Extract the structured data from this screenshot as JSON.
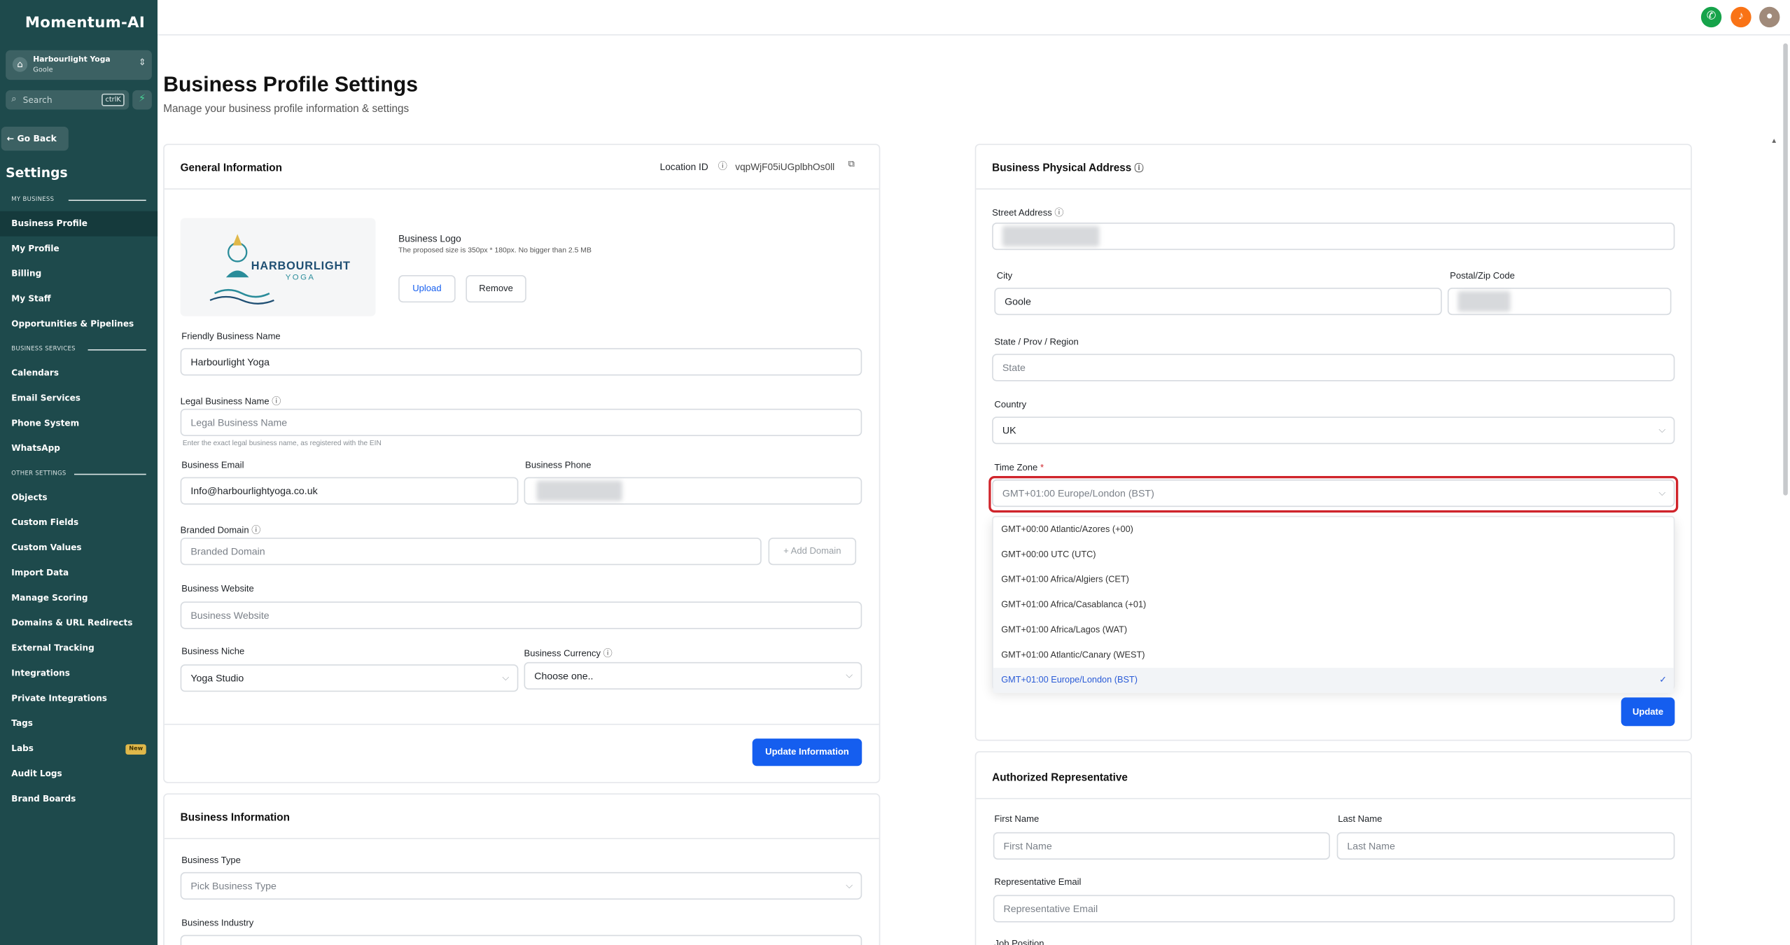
{
  "app": {
    "name": "Momentum-AI"
  },
  "account": {
    "name": "Harbourlight Yoga",
    "location": "Goole"
  },
  "search": {
    "placeholder": "Search",
    "shortcut": "ctrlK"
  },
  "sidebar": {
    "go_back": "Go Back",
    "title": "Settings",
    "sections": {
      "my_business": "MY BUSINESS",
      "business_services": "BUSINESS SERVICES",
      "other_settings": "OTHER SETTINGS"
    },
    "items": [
      {
        "label": "Business Profile"
      },
      {
        "label": "My Profile"
      },
      {
        "label": "Billing"
      },
      {
        "label": "My Staff"
      },
      {
        "label": "Opportunities & Pipelines"
      },
      {
        "label": "Calendars"
      },
      {
        "label": "Email Services"
      },
      {
        "label": "Phone System"
      },
      {
        "label": "WhatsApp"
      },
      {
        "label": "Objects"
      },
      {
        "label": "Custom Fields"
      },
      {
        "label": "Custom Values"
      },
      {
        "label": "Import Data"
      },
      {
        "label": "Manage Scoring"
      },
      {
        "label": "Domains & URL Redirects"
      },
      {
        "label": "External Tracking"
      },
      {
        "label": "Integrations"
      },
      {
        "label": "Private Integrations"
      },
      {
        "label": "Tags"
      },
      {
        "label": "Labs"
      },
      {
        "label": "Audit Logs"
      },
      {
        "label": "Brand Boards"
      }
    ],
    "labs_badge": "New"
  },
  "page": {
    "title": "Business Profile Settings",
    "subtitle": "Manage your business profile information & settings"
  },
  "general": {
    "title": "General Information",
    "location_id_label": "Location ID",
    "location_id": "vqpWjF05iUGplbhOs0ll",
    "logo_label": "Business Logo",
    "logo_hint": "The proposed size is 350px * 180px. No bigger than 2.5 MB",
    "upload": "Upload",
    "remove": "Remove",
    "logo_text": "HARBOURLIGHT",
    "logo_sub": "YOGA",
    "friendly_name_label": "Friendly Business Name",
    "friendly_name": "Harbourlight Yoga",
    "legal_name_label": "Legal Business Name",
    "legal_name_placeholder": "Legal Business Name",
    "legal_name_hint": "Enter the exact legal business name, as registered with the EIN",
    "email_label": "Business Email",
    "email": "Info@harbourlightyoga.co.uk",
    "phone_label": "Business Phone",
    "domain_label": "Branded Domain",
    "domain_placeholder": "Branded Domain",
    "add_domain": "+ Add Domain",
    "website_label": "Business Website",
    "website_placeholder": "Business Website",
    "niche_label": "Business Niche",
    "niche": "Yoga Studio",
    "currency_label": "Business Currency",
    "currency_placeholder": "Choose one..",
    "update_button": "Update Information"
  },
  "business_info": {
    "title": "Business Information",
    "type_label": "Business Type",
    "type_placeholder": "Pick Business Type",
    "industry_label": "Business Industry"
  },
  "address": {
    "title": "Business Physical Address",
    "street_label": "Street Address",
    "city_label": "City",
    "city": "Goole",
    "postal_label": "Postal/Zip Code",
    "state_label": "State / Prov / Region",
    "state_placeholder": "State",
    "country_label": "Country",
    "country": "UK",
    "timezone_label": "Time Zone",
    "required_mark": "*",
    "timezone_value": "GMT+01:00 Europe/London (BST)",
    "timezone_options": [
      "GMT+00:00 Atlantic/Azores (+00)",
      "GMT+00:00 UTC (UTC)",
      "GMT+01:00 Africa/Algiers (CET)",
      "GMT+01:00 Africa/Casablanca (+01)",
      "GMT+01:00 Africa/Lagos (WAT)",
      "GMT+01:00 Atlantic/Canary (WEST)",
      "GMT+01:00 Europe/London (BST)"
    ],
    "update_button": "Update"
  },
  "rep": {
    "title": "Authorized Representative",
    "first_label": "First Name",
    "first_placeholder": "First Name",
    "last_label": "Last Name",
    "last_placeholder": "Last Name",
    "email_label": "Representative Email",
    "email_placeholder": "Representative Email",
    "job_label": "Job Position"
  },
  "colors": {
    "sidebar": "#1e4a4c",
    "primary": "#155eef",
    "highlight": "#d0242b",
    "phone": "#16a34a",
    "bell": "#f97316"
  }
}
